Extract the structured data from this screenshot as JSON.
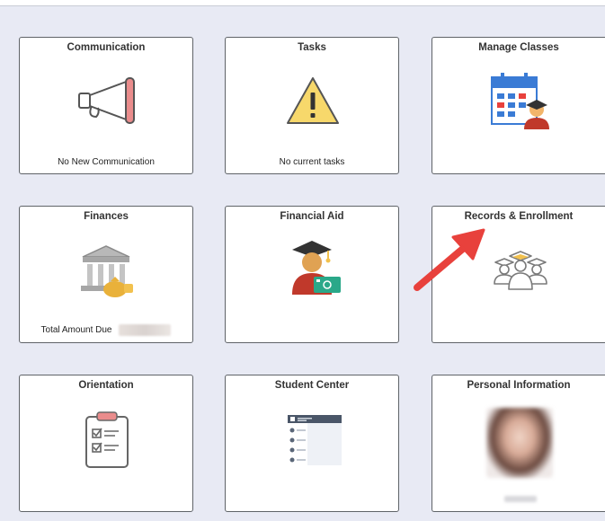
{
  "tiles": {
    "communication": {
      "title": "Communication",
      "footer": "No New Communication"
    },
    "tasks": {
      "title": "Tasks",
      "footer": "No current tasks"
    },
    "manage_classes": {
      "title": "Manage Classes"
    },
    "finances": {
      "title": "Finances",
      "footer_label": "Total Amount Due"
    },
    "financial_aid": {
      "title": "Financial Aid"
    },
    "records_enrollment": {
      "title": "Records & Enrollment"
    },
    "orientation": {
      "title": "Orientation"
    },
    "student_center": {
      "title": "Student Center"
    },
    "personal_information": {
      "title": "Personal Information"
    }
  },
  "colors": {
    "page_bg": "#e8eaf4",
    "tile_border": "#5f6368",
    "annotation_arrow": "#e8413c",
    "warning_yellow": "#f7d86b",
    "calendar_blue": "#3a7bd5",
    "money_green": "#2aa889"
  },
  "icons": {
    "communication": "megaphone-icon",
    "tasks": "warning-icon",
    "manage_classes": "calendar-graduate-icon",
    "finances": "bank-moneybag-icon",
    "financial_aid": "graduate-money-icon",
    "records_enrollment": "graduates-group-icon",
    "orientation": "clipboard-checklist-icon",
    "student_center": "student-center-panel-icon"
  }
}
